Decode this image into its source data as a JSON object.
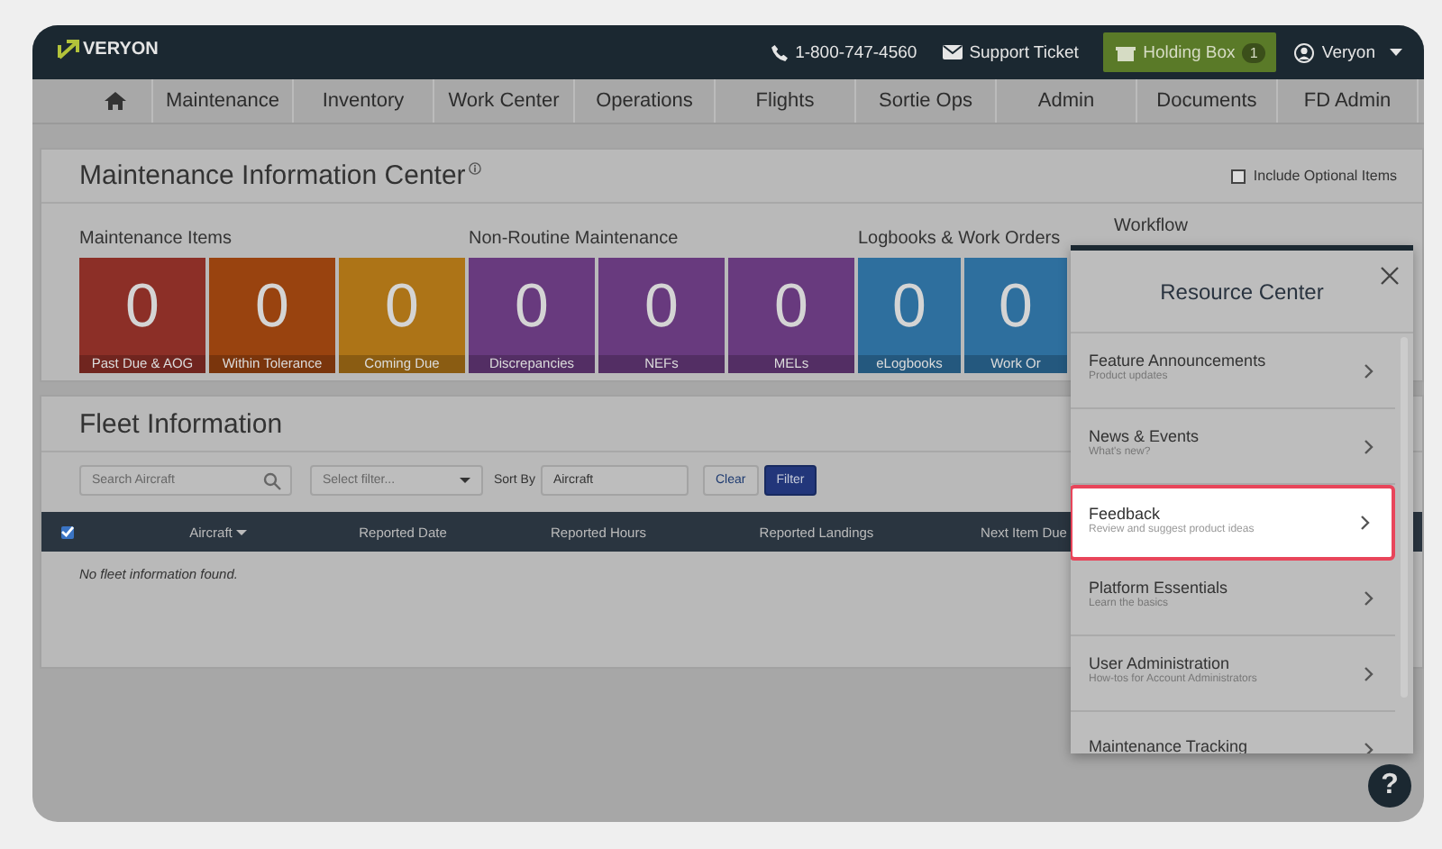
{
  "header": {
    "logo": "VERYON",
    "phone": "1-800-747-4560",
    "support": "Support Ticket",
    "holding_box": {
      "label": "Holding Box",
      "count": "1"
    },
    "user": "Veryon"
  },
  "nav": [
    {
      "kind": "home"
    },
    {
      "kind": "text",
      "label": "Maintenance"
    },
    {
      "kind": "text",
      "label": "Inventory"
    },
    {
      "kind": "text",
      "label": "Work Center"
    },
    {
      "kind": "text",
      "label": "Operations"
    },
    {
      "kind": "text",
      "label": "Flights"
    },
    {
      "kind": "text",
      "label": "Sortie Ops"
    },
    {
      "kind": "text",
      "label": "Admin"
    },
    {
      "kind": "text",
      "label": "Documents"
    },
    {
      "kind": "text",
      "label": "FD Admin"
    }
  ],
  "maintenance": {
    "title": "Maintenance Information Center",
    "include_optional": {
      "label": "Include Optional Items",
      "checked": false
    },
    "groups": [
      {
        "title": "Maintenance Items",
        "tiles": [
          {
            "count": "0",
            "label": "Past Due & AOG",
            "color": "#8c2f27"
          },
          {
            "count": "0",
            "label": "Within Tolerance",
            "color": "#99430f"
          },
          {
            "count": "0",
            "label": "Coming Due",
            "color": "#ad7417"
          }
        ]
      },
      {
        "title": "Non-Routine Maintenance",
        "tiles": [
          {
            "count": "0",
            "label": "Discrepancies",
            "color": "#683a7e"
          },
          {
            "count": "0",
            "label": "NEFs",
            "color": "#683a7e"
          },
          {
            "count": "0",
            "label": "MELs",
            "color": "#683a7e"
          }
        ]
      },
      {
        "title": "Logbooks & Work Orders",
        "tiles": [
          {
            "count": "0",
            "label": "eLogbooks",
            "color": "#2e6f9e"
          },
          {
            "count": "0",
            "label": "Work Or",
            "color": "#2e6f9e"
          }
        ]
      },
      {
        "title": "Workflow"
      }
    ]
  },
  "fleet": {
    "title": "Fleet Information",
    "search": {
      "placeholder": "Search Aircraft"
    },
    "filter": {
      "placeholder": "Select filter..."
    },
    "sort_label": "Sort By",
    "sort_value": "Aircraft",
    "buttons": [
      {
        "label": "Clear",
        "kind": "secondary"
      },
      {
        "label": "Filter",
        "kind": "primary"
      }
    ],
    "select_all": {
      "checked": true
    },
    "columns": [
      {
        "label": "Aircraft",
        "sorted": true
      },
      {
        "label": "Reported Date",
        "sorted": false
      },
      {
        "label": "Reported Hours",
        "sorted": false
      },
      {
        "label": "Reported Landings",
        "sorted": false
      },
      {
        "label": "Next Item Due",
        "sorted": false
      }
    ],
    "empty": "No fleet information found."
  },
  "resource_center": {
    "title": "Resource Center",
    "items": [
      {
        "title": "Feature Announcements",
        "subtitle": "Product updates",
        "selected": false
      },
      {
        "title": "News & Events",
        "subtitle": "What's new?",
        "selected": false
      },
      {
        "title": "Feedback",
        "subtitle": "Review and suggest product ideas",
        "selected": true
      },
      {
        "title": "Platform Essentials",
        "subtitle": "Learn the basics",
        "selected": false
      },
      {
        "title": "User Administration",
        "subtitle": "How-tos for Account Administrators",
        "selected": false
      },
      {
        "title": "Maintenance Tracking",
        "selected": false
      }
    ]
  },
  "help": "?"
}
